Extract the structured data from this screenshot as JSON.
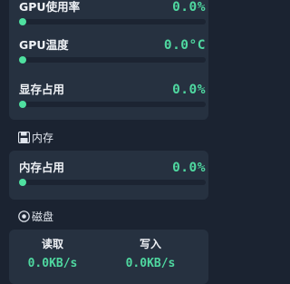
{
  "gpu": {
    "metrics": [
      {
        "label": "GPU使用率",
        "value": "0.0%",
        "progress": 0.0
      },
      {
        "label": "GPU温度",
        "value": "0.0°C",
        "progress": 0.0
      },
      {
        "label": "显存占用",
        "value": "0.0%",
        "progress": 0.0
      }
    ]
  },
  "memory": {
    "section_title": "内存",
    "metrics": [
      {
        "label": "内存占用",
        "value": "0.0%",
        "progress": 0.0
      }
    ]
  },
  "disk": {
    "section_title": "磁盘",
    "read_label": "读取",
    "read_value": "0.0KB/s",
    "write_label": "写入",
    "write_value": "0.0KB/s"
  },
  "colors": {
    "accent": "#4fd8a0",
    "card": "#263140",
    "background": "#1b2331",
    "track": "#1c2432"
  },
  "icons": {
    "memory": "floppy-disk-icon",
    "disk": "disk-circle-icon"
  }
}
